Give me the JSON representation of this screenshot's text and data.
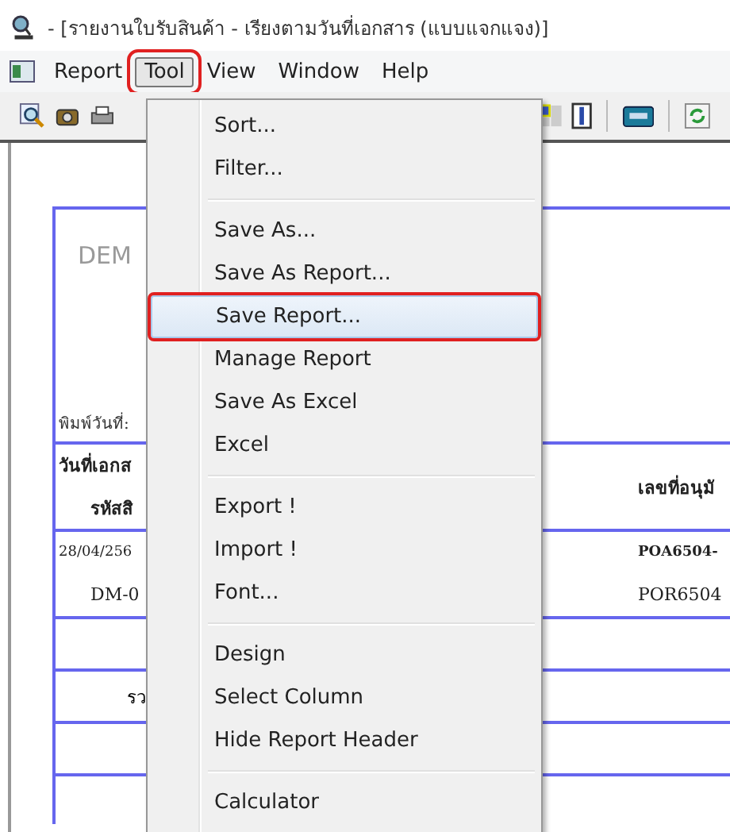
{
  "window": {
    "title": "- [รายงานใบรับสินค้า - เรียงตามวันที่เอกสาร (แบบแจกแจง)]"
  },
  "menubar": [
    {
      "label": "Report",
      "selected": false,
      "annotated": false
    },
    {
      "label": "Tool",
      "selected": true,
      "annotated": true
    },
    {
      "label": "View",
      "selected": false,
      "annotated": false
    },
    {
      "label": "Window",
      "selected": false,
      "annotated": false
    },
    {
      "label": "Help",
      "selected": false,
      "annotated": false
    }
  ],
  "dropdown": {
    "groups": [
      [
        {
          "label": "Sort...",
          "selected": false,
          "annotated": false
        },
        {
          "label": "Filter...",
          "selected": false,
          "annotated": false
        }
      ],
      [
        {
          "label": "Save As...",
          "selected": false,
          "annotated": false
        },
        {
          "label": "Save As Report...",
          "selected": false,
          "annotated": false
        },
        {
          "label": "Save Report...",
          "selected": true,
          "annotated": true
        },
        {
          "label": "Manage Report",
          "selected": false,
          "annotated": false
        },
        {
          "label": "Save As Excel",
          "selected": false,
          "annotated": false
        },
        {
          "label": "Excel",
          "selected": false,
          "annotated": false
        }
      ],
      [
        {
          "label": "Export !",
          "selected": false,
          "annotated": false
        },
        {
          "label": "Import !",
          "selected": false,
          "annotated": false
        },
        {
          "label": "Font...",
          "selected": false,
          "annotated": false
        }
      ],
      [
        {
          "label": "Design",
          "selected": false,
          "annotated": false
        },
        {
          "label": "Select Column",
          "selected": false,
          "annotated": false
        },
        {
          "label": "Hide Report Header",
          "selected": false,
          "annotated": false
        }
      ],
      [
        {
          "label": "Calculator",
          "selected": false,
          "annotated": false
        }
      ]
    ]
  },
  "report": {
    "watermark": "DEM",
    "print_date_label": "พิมพ์วันที่:",
    "header_left": [
      "วันที่เอกส",
      "รหัสสิ"
    ],
    "header_right": "เลขที่อนุมั",
    "row_left": [
      "28/04/256",
      "DM-0"
    ],
    "row_right": [
      "POA6504-",
      "POR6504"
    ],
    "total_label": "รว"
  }
}
